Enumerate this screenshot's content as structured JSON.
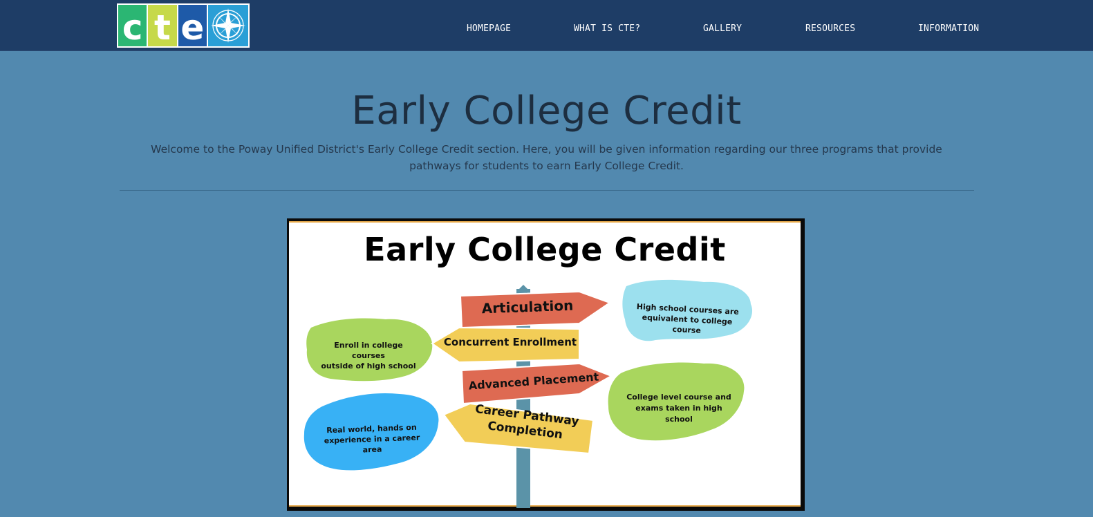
{
  "header": {
    "logo": {
      "letters": [
        "c",
        "t",
        "e"
      ],
      "icon": "compass-rose-icon",
      "colors": [
        "#2bb673",
        "#c6d94a",
        "#1e5aa8",
        "#2a9fd6"
      ]
    },
    "nav": [
      {
        "label": "HOMEPAGE"
      },
      {
        "label": "WHAT IS CTE?"
      },
      {
        "label": "GALLERY"
      },
      {
        "label": "RESOURCES"
      },
      {
        "label": "INFORMATION"
      }
    ]
  },
  "main": {
    "title": "Early College Credit",
    "intro_line1": "Welcome to the Poway Unified District's Early College Credit section. Here, you will be given information regarding our three programs that provide",
    "intro_line2": "pathways for students to earn Early College Credit."
  },
  "infographic": {
    "title": "Early College Credit",
    "signs": [
      {
        "label": "Articulation",
        "color": "#de6a52"
      },
      {
        "label": "Concurrent Enrollment",
        "color": "#f2cd57"
      },
      {
        "label": "Advanced Placement",
        "color": "#de6a52"
      },
      {
        "label_line1": "Career Pathway",
        "label_line2": "Completion",
        "color": "#f2cd57"
      }
    ],
    "blobs": [
      {
        "line1": "High school courses are",
        "line2": "equivalent to college course",
        "color": "#9ce0ee"
      },
      {
        "line1": "Enroll in college courses",
        "line2": "outside of high school",
        "color": "#a9d65e"
      },
      {
        "line1": "College level course and",
        "line2": "exams taken in high",
        "line3": "school",
        "color": "#a9d65e"
      },
      {
        "line1": "Real world, hands on",
        "line2": "experience in a career area",
        "color": "#38b1f5"
      }
    ]
  },
  "colors": {
    "page_background": "#5289af",
    "header_background": "#1e3d66",
    "post_color": "#5b93a8"
  }
}
